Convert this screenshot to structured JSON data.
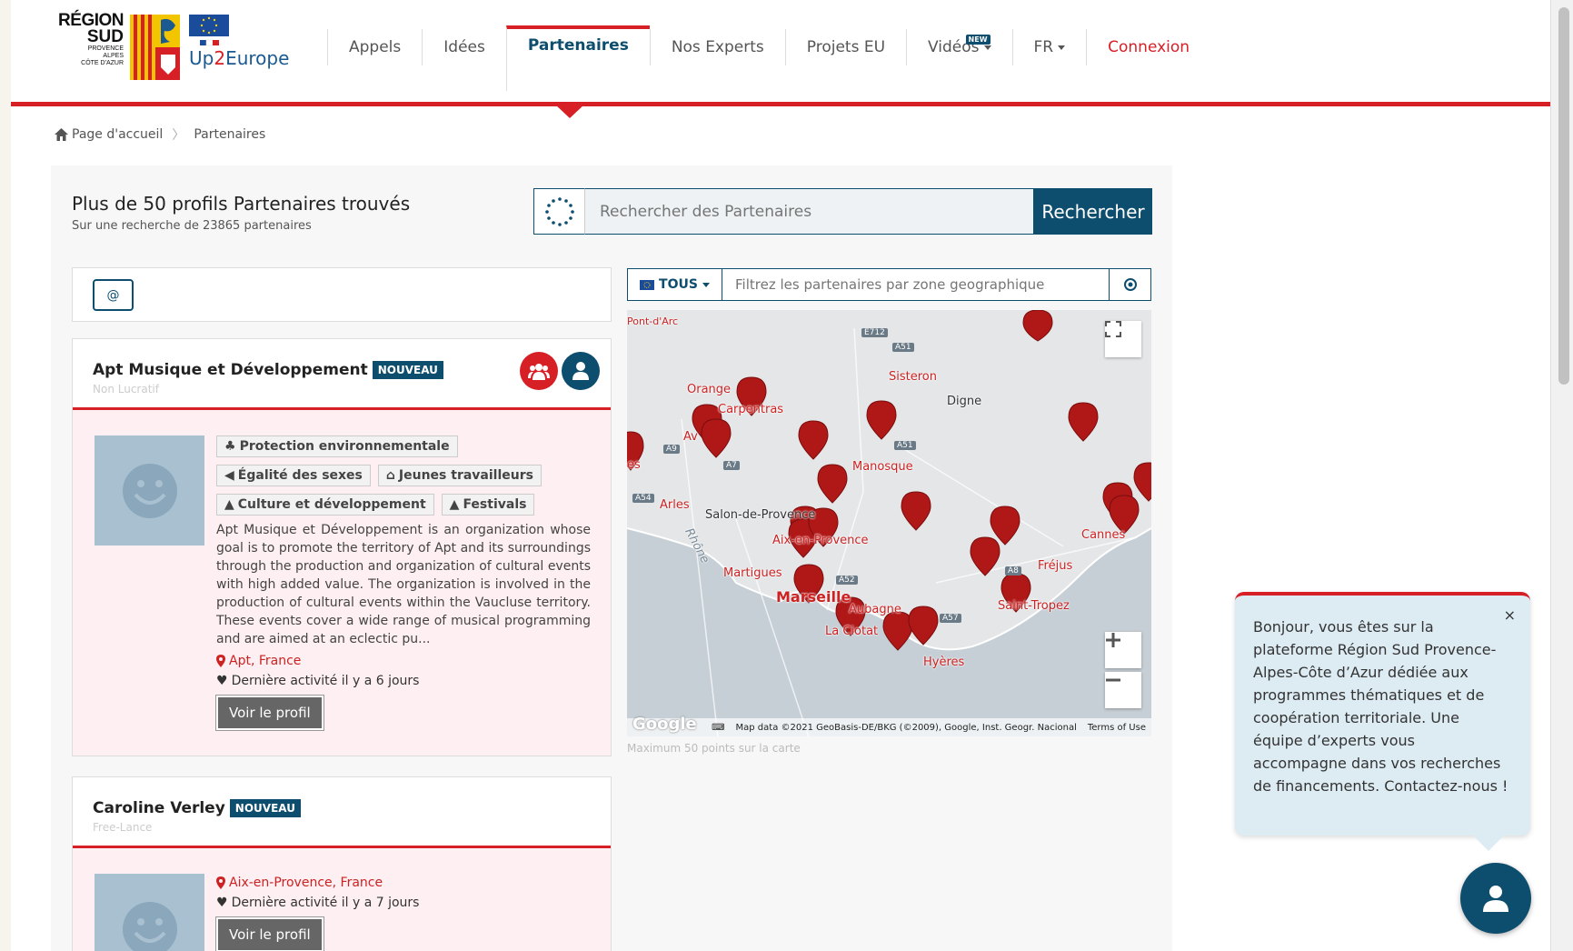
{
  "logo": {
    "region_line1": "RÉGION",
    "region_line2": "SUD",
    "region_line3": "PROVENCE",
    "region_line4": "ALPES",
    "region_line5": "CÔTE D'AZUR",
    "up_prefix": "Up",
    "up_two": "2",
    "up_suffix": "Europe"
  },
  "nav": {
    "items": [
      {
        "label": "Appels"
      },
      {
        "label": "Idées"
      },
      {
        "label": "Partenaires"
      },
      {
        "label": "Nos Experts"
      },
      {
        "label": "Projets EU"
      },
      {
        "label": "Vidéos"
      },
      {
        "label": "FR"
      },
      {
        "label": "Connexion"
      }
    ],
    "new_badge": "NEW"
  },
  "breadcrumb": {
    "home": "Page d'accueil",
    "separator": "〉",
    "current": "Partenaires"
  },
  "results": {
    "title": "Plus de 50 profils Partenaires trouvés",
    "subtitle": "Sur une recherche de 23865 partenaires"
  },
  "search": {
    "placeholder": "Rechercher des Partenaires",
    "button": "Rechercher"
  },
  "filter": {
    "at_label": "@"
  },
  "cards": [
    {
      "name": "Apt Musique et Développement",
      "badge": "NOUVEAU",
      "type": "Non Lucratif",
      "tags": [
        "Protection environnementale",
        "Égalité des sexes",
        "Jeunes travailleurs",
        "Culture et développement",
        "Festivals"
      ],
      "description": "Apt Musique et Développement is an organization whose goal is to promote the territory of Apt and its surroundings through the production and organization of cultural events with high added value. The organization is involved in the production of cultural events within the Vaucluse territory. These events cover a wide range of musical programming and are aimed at an eclectic pu...",
      "location": "Apt, France",
      "activity": "Dernière activité il y a 6 jours",
      "button": "Voir le profil"
    },
    {
      "name": "Caroline Verley",
      "badge": "NOUVEAU",
      "type": "Free-Lance",
      "location": "Aix-en-Provence, France",
      "activity": "Dernière activité il y a 7 jours",
      "button": "Voir le profil"
    }
  ],
  "geo": {
    "tous": "TOUS",
    "placeholder": "Filtrez les partenaires par zone geographique"
  },
  "map": {
    "labels": {
      "pont_darc": "Pont-d'Arc",
      "orange": "Orange",
      "carpentras": "Carpentras",
      "avignon": "Av",
      "arles_partial": "es",
      "arles": "Arles",
      "sisteron": "Sisteron",
      "digne": "Digne",
      "manosque": "Manosque",
      "salon": "Salon-de-Provence",
      "aix": "Aix-en-Provence",
      "martigues": "Martigues",
      "marseille": "Marseille",
      "aubagne": "Aubagne",
      "la_ciotat": "La Ciotat",
      "hyeres": "Hyères",
      "frejus": "Fréjus",
      "saint_tropez": "Saint-Tropez",
      "cannes": "Cannes",
      "rhone": "Rhône"
    },
    "roads": [
      "E712",
      "A51",
      "A51",
      "A9",
      "A7",
      "A54",
      "A52",
      "A57",
      "A8"
    ],
    "footer_data": "Map data ©2021 GeoBasis-DE/BKG (©2009), Google, Inst. Geogr. Nacional",
    "footer_terms": "Terms of Use",
    "google": "Google",
    "note": "Maximum 50 points sur la carte"
  },
  "chat": {
    "message": "Bonjour, vous êtes sur la plateforme Région Sud Provence-Alpes-Côte d’Azur dédiée aux programmes thématiques et de coopération territoriale. Une équipe d’experts vous accompagne dans vos recherches de financements. Contactez-nous !",
    "close": "×"
  },
  "colors": {
    "accent_red": "#d71f26",
    "brand_blue": "#0d4d6e",
    "card_pink": "#fdeff2"
  }
}
